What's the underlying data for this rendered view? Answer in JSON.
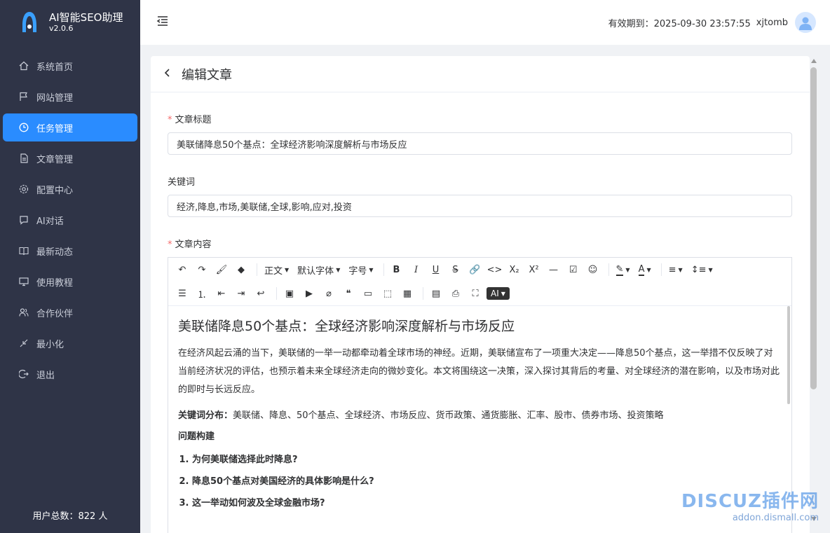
{
  "app": {
    "name": "AI智能SEO助理",
    "version": "v2.0.6"
  },
  "sidebar": {
    "items": [
      {
        "label": "系统首页",
        "icon": "home-icon"
      },
      {
        "label": "网站管理",
        "icon": "flag-icon"
      },
      {
        "label": "任务管理",
        "icon": "clock-icon",
        "active": true
      },
      {
        "label": "文章管理",
        "icon": "document-icon"
      },
      {
        "label": "配置中心",
        "icon": "gear-icon"
      },
      {
        "label": "AI对话",
        "icon": "chat-icon"
      },
      {
        "label": "最新动态",
        "icon": "book-icon"
      },
      {
        "label": "使用教程",
        "icon": "monitor-icon"
      },
      {
        "label": "合作伙伴",
        "icon": "partner-icon"
      },
      {
        "label": "最小化",
        "icon": "minimize-icon"
      },
      {
        "label": "退出",
        "icon": "logout-icon"
      }
    ],
    "user_count": "用户总数：822 人"
  },
  "header": {
    "expiry": "有效期到：2025-09-30 23:57:55",
    "username": "xjtomb"
  },
  "page": {
    "title": "编辑文章",
    "title_label": "文章标题",
    "title_value": "美联储降息50个基点：全球经济影响深度解析与市场反应",
    "keywords_label": "关键词",
    "keywords_value": "经济,降息,市场,美联储,全球,影响,应对,投资",
    "content_label": "文章内容"
  },
  "editor": {
    "toolbar": {
      "paragraph": "正文",
      "font": "默认字体",
      "size": "字号",
      "ai": "AI"
    },
    "content": {
      "heading": "美联储降息50个基点：全球经济影响深度解析与市场反应",
      "para1": "在经济风起云涌的当下，美联储的一举一动都牵动着全球市场的神经。近期，美联储宣布了一项重大决定——降息50个基点，这一举措不仅反映了对当前经济状况的评估，也预示着未来全球经济走向的微妙变化。本文将围绕这一决策，深入探讨其背后的考量、对全球经济的潜在影响，以及市场对此的即时与长远反应。",
      "kw_label": "关键词分布：",
      "kw_text": "美联储、降息、50个基点、全球经济、市场反应、货币政策、通货膨胀、汇率、股市、债券市场、投资策略",
      "q_heading": "问题构建",
      "questions": [
        "为何美联储选择此时降息?",
        "降息50个基点对美国经济的具体影响是什么?",
        "这一举动如何波及全球金融市场?"
      ]
    }
  },
  "watermark": {
    "text": "DISCUZ插件网",
    "url": "addon.dismall.com"
  }
}
